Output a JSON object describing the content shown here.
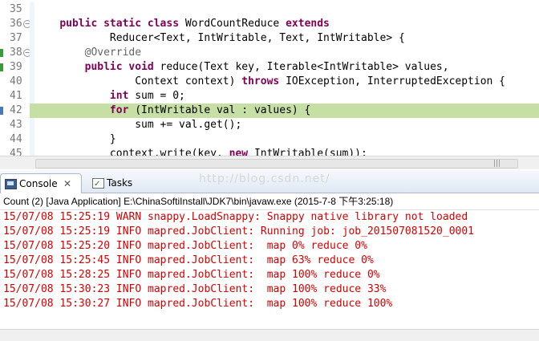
{
  "editor": {
    "lines": [
      {
        "number": "35",
        "fold": false,
        "mark": "",
        "highlight": false,
        "tokens": []
      },
      {
        "number": "36",
        "fold": true,
        "mark": "",
        "highlight": false,
        "tokens": [
          {
            "t": "    ",
            "c": ""
          },
          {
            "t": "public static class ",
            "c": "kw"
          },
          {
            "t": "WordCountReduce ",
            "c": ""
          },
          {
            "t": "extends",
            "c": "kw"
          }
        ]
      },
      {
        "number": "37",
        "fold": false,
        "mark": "",
        "highlight": false,
        "tokens": [
          {
            "t": "            Reducer<Text, IntWritable, Text, IntWritable> {",
            "c": ""
          }
        ]
      },
      {
        "number": "38",
        "fold": true,
        "mark": "#3a9a3a",
        "highlight": false,
        "tokens": [
          {
            "t": "        ",
            "c": ""
          },
          {
            "t": "@Override",
            "c": "an"
          }
        ]
      },
      {
        "number": "39",
        "fold": false,
        "mark": "#3a9a3a",
        "highlight": false,
        "tokens": [
          {
            "t": "        ",
            "c": ""
          },
          {
            "t": "public void ",
            "c": "kw"
          },
          {
            "t": "reduce(Text key, Iterable<IntWritable> values,",
            "c": ""
          }
        ]
      },
      {
        "number": "40",
        "fold": false,
        "mark": "",
        "highlight": false,
        "tokens": [
          {
            "t": "                Context context) ",
            "c": ""
          },
          {
            "t": "throws ",
            "c": "kw"
          },
          {
            "t": "IOException, InterruptedException {",
            "c": ""
          }
        ]
      },
      {
        "number": "41",
        "fold": false,
        "mark": "",
        "highlight": false,
        "tokens": [
          {
            "t": "            ",
            "c": ""
          },
          {
            "t": "int ",
            "c": "kw"
          },
          {
            "t": "sum = 0;",
            "c": ""
          }
        ]
      },
      {
        "number": "42",
        "fold": false,
        "mark": "#4a78b8",
        "highlight": true,
        "tokens": [
          {
            "t": "            ",
            "c": ""
          },
          {
            "t": "for ",
            "c": "kw"
          },
          {
            "t": "(IntWritable val : values) {",
            "c": ""
          }
        ]
      },
      {
        "number": "43",
        "fold": false,
        "mark": "",
        "highlight": false,
        "tokens": [
          {
            "t": "                sum += val.get();",
            "c": ""
          }
        ]
      },
      {
        "number": "44",
        "fold": false,
        "mark": "",
        "highlight": false,
        "tokens": [
          {
            "t": "            }",
            "c": ""
          }
        ]
      },
      {
        "number": "45",
        "fold": false,
        "mark": "",
        "highlight": false,
        "tokens": [
          {
            "t": "            context.write(key, ",
            "c": ""
          },
          {
            "t": "new ",
            "c": "kw"
          },
          {
            "t": "IntWritable(sum));",
            "c": ""
          }
        ]
      }
    ]
  },
  "view": {
    "tabs": [
      {
        "label": "Console",
        "active": true
      },
      {
        "label": "Tasks",
        "active": false
      }
    ],
    "close_glyph": "✕",
    "watermark": "http://blog.csdn.net/"
  },
  "console": {
    "description": "Count (2) [Java Application] E:\\ChinaSoftiInstall\\JDK7\\bin\\javaw.exe (2015-7-8 下午3:25:18)",
    "lines": [
      "15/07/08 15:25:19 WARN snappy.LoadSnappy: Snappy native library not loaded",
      "15/07/08 15:25:19 INFO mapred.JobClient: Running job: job_201507081520_0001",
      "15/07/08 15:25:20 INFO mapred.JobClient:  map 0% reduce 0%",
      "15/07/08 15:25:45 INFO mapred.JobClient:  map 63% reduce 0%",
      "15/07/08 15:28:25 INFO mapred.JobClient:  map 100% reduce 0%",
      "15/07/08 15:30:23 INFO mapred.JobClient:  map 100% reduce 33%",
      "15/07/08 15:30:27 INFO mapred.JobClient:  map 100% reduce 100%"
    ]
  },
  "colors": {
    "keyword": "#7f0055",
    "annotation": "#646464",
    "line_highlight": "#c6dfa5",
    "console_text": "#d40000"
  }
}
